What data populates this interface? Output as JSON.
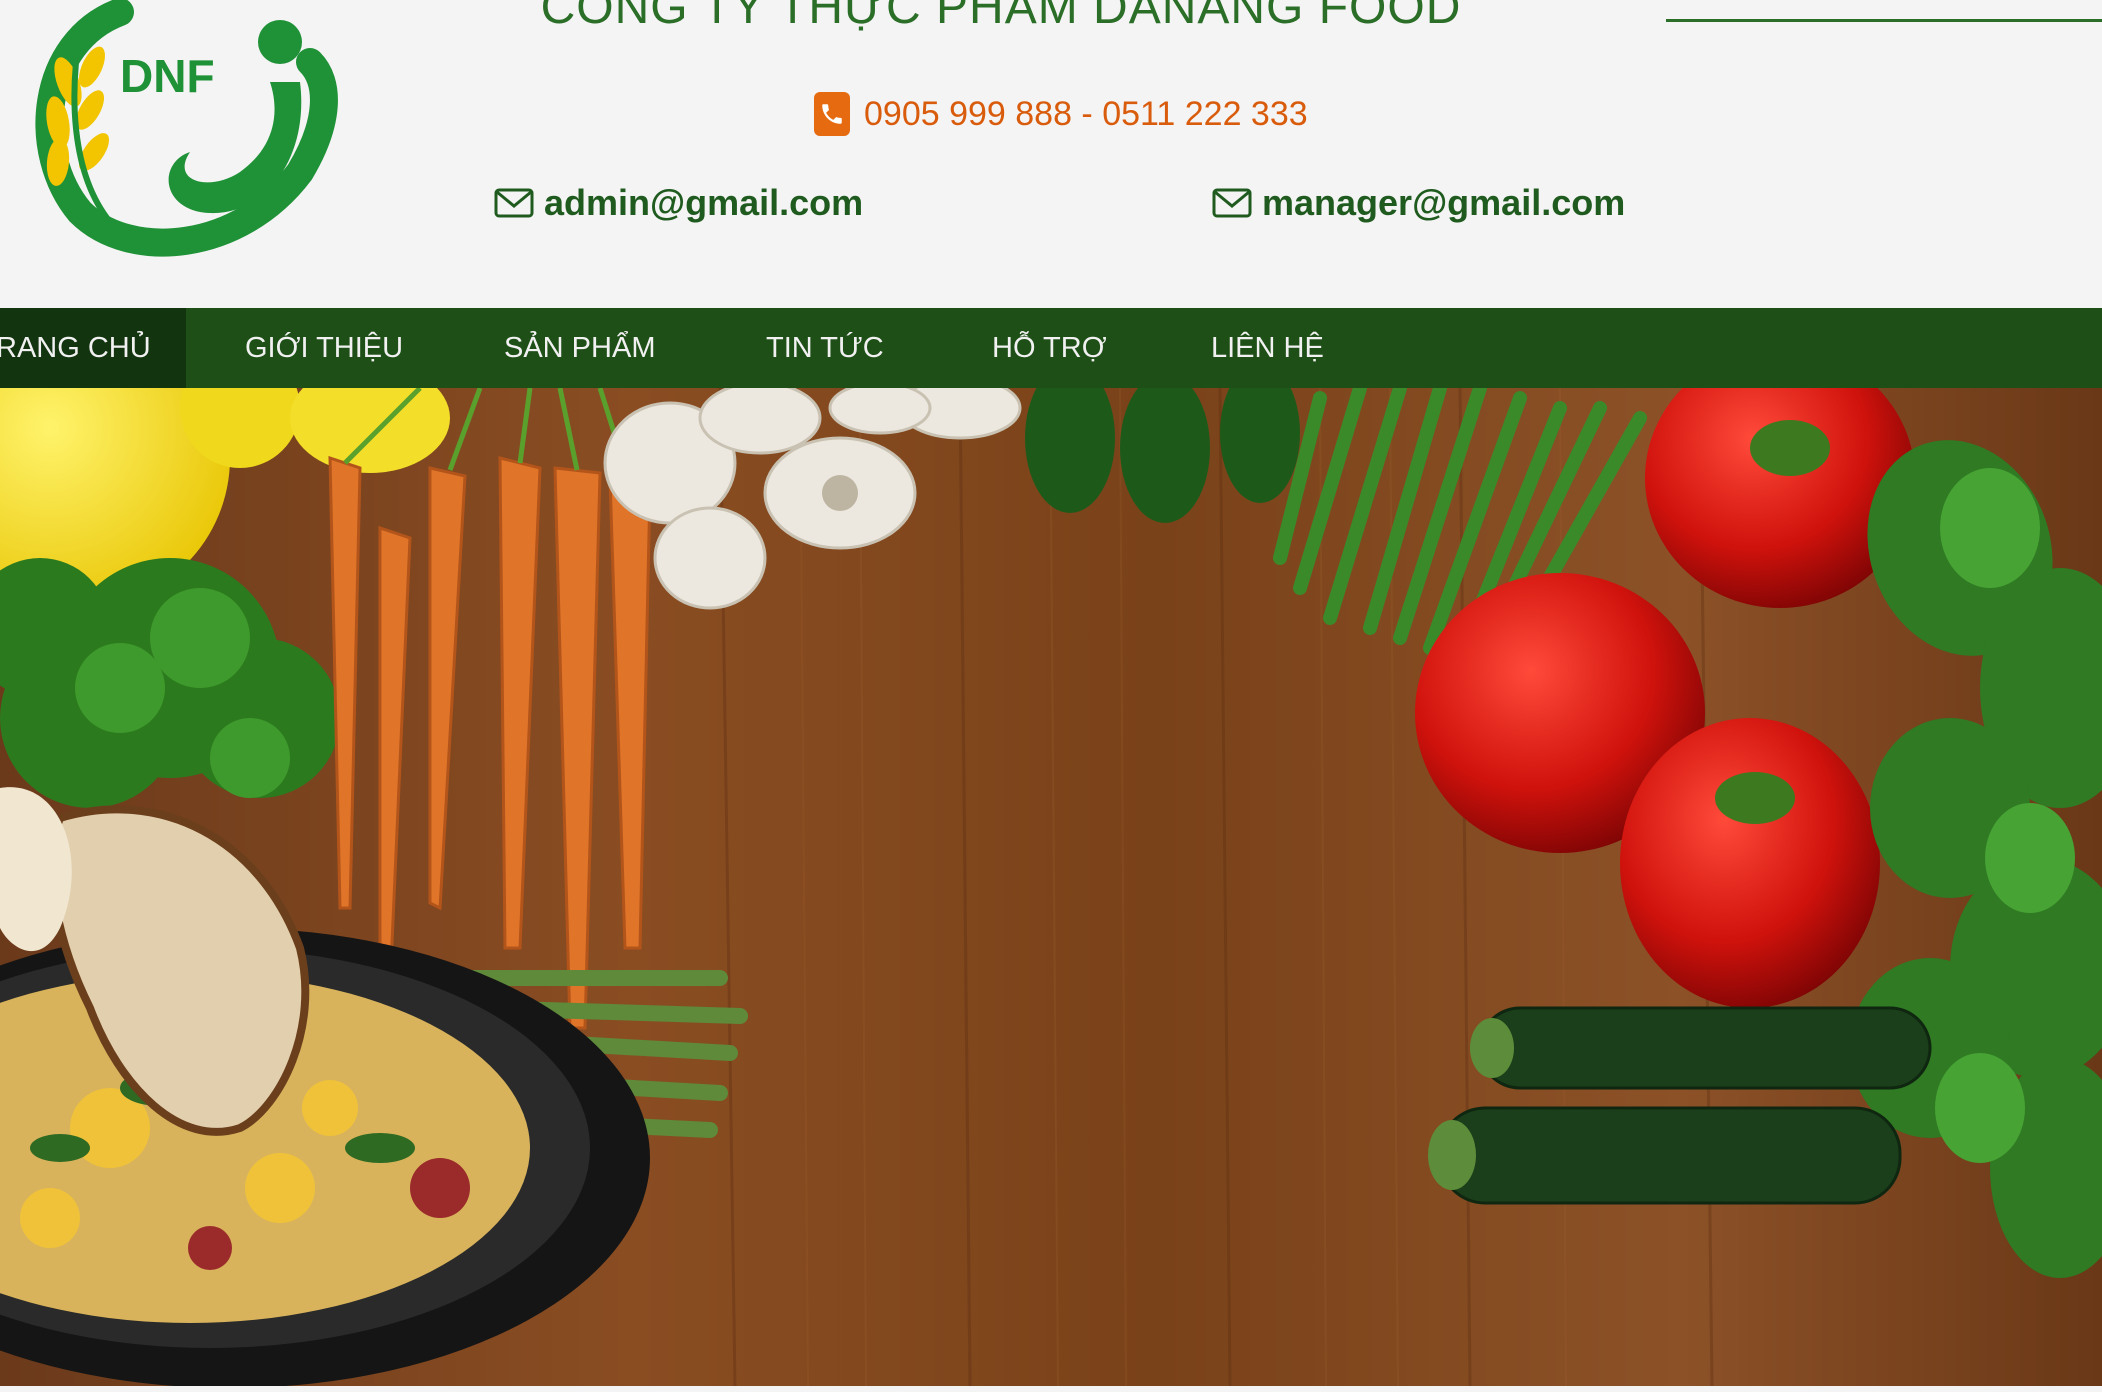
{
  "header": {
    "logo_text": "DNF",
    "company_name": "CÔNG TY THỰC PHẨM DANANG FOOD",
    "phone": "0905 999 888 - 0511 222 333",
    "emails": [
      "admin@gmail.com",
      "manager@gmail.com"
    ]
  },
  "nav": {
    "items": [
      {
        "label": "TRANG CHỦ",
        "visible_label": "RANG CHỦ",
        "active": true
      },
      {
        "label": "GIỚI THIỆU",
        "active": false
      },
      {
        "label": "SẢN PHẨM",
        "active": false
      },
      {
        "label": "TIN TỨC",
        "active": false
      },
      {
        "label": "HỖ TRỢ",
        "active": false
      },
      {
        "label": "LIÊN HỆ",
        "active": false
      }
    ]
  },
  "colors": {
    "brand_green": "#2a6e27",
    "nav_green": "#1e4f17",
    "nav_active": "#12340e",
    "phone_orange": "#d95c0d",
    "header_bg": "#f4f4f4"
  },
  "hero": {
    "icon": "vegetables-banner-image"
  }
}
